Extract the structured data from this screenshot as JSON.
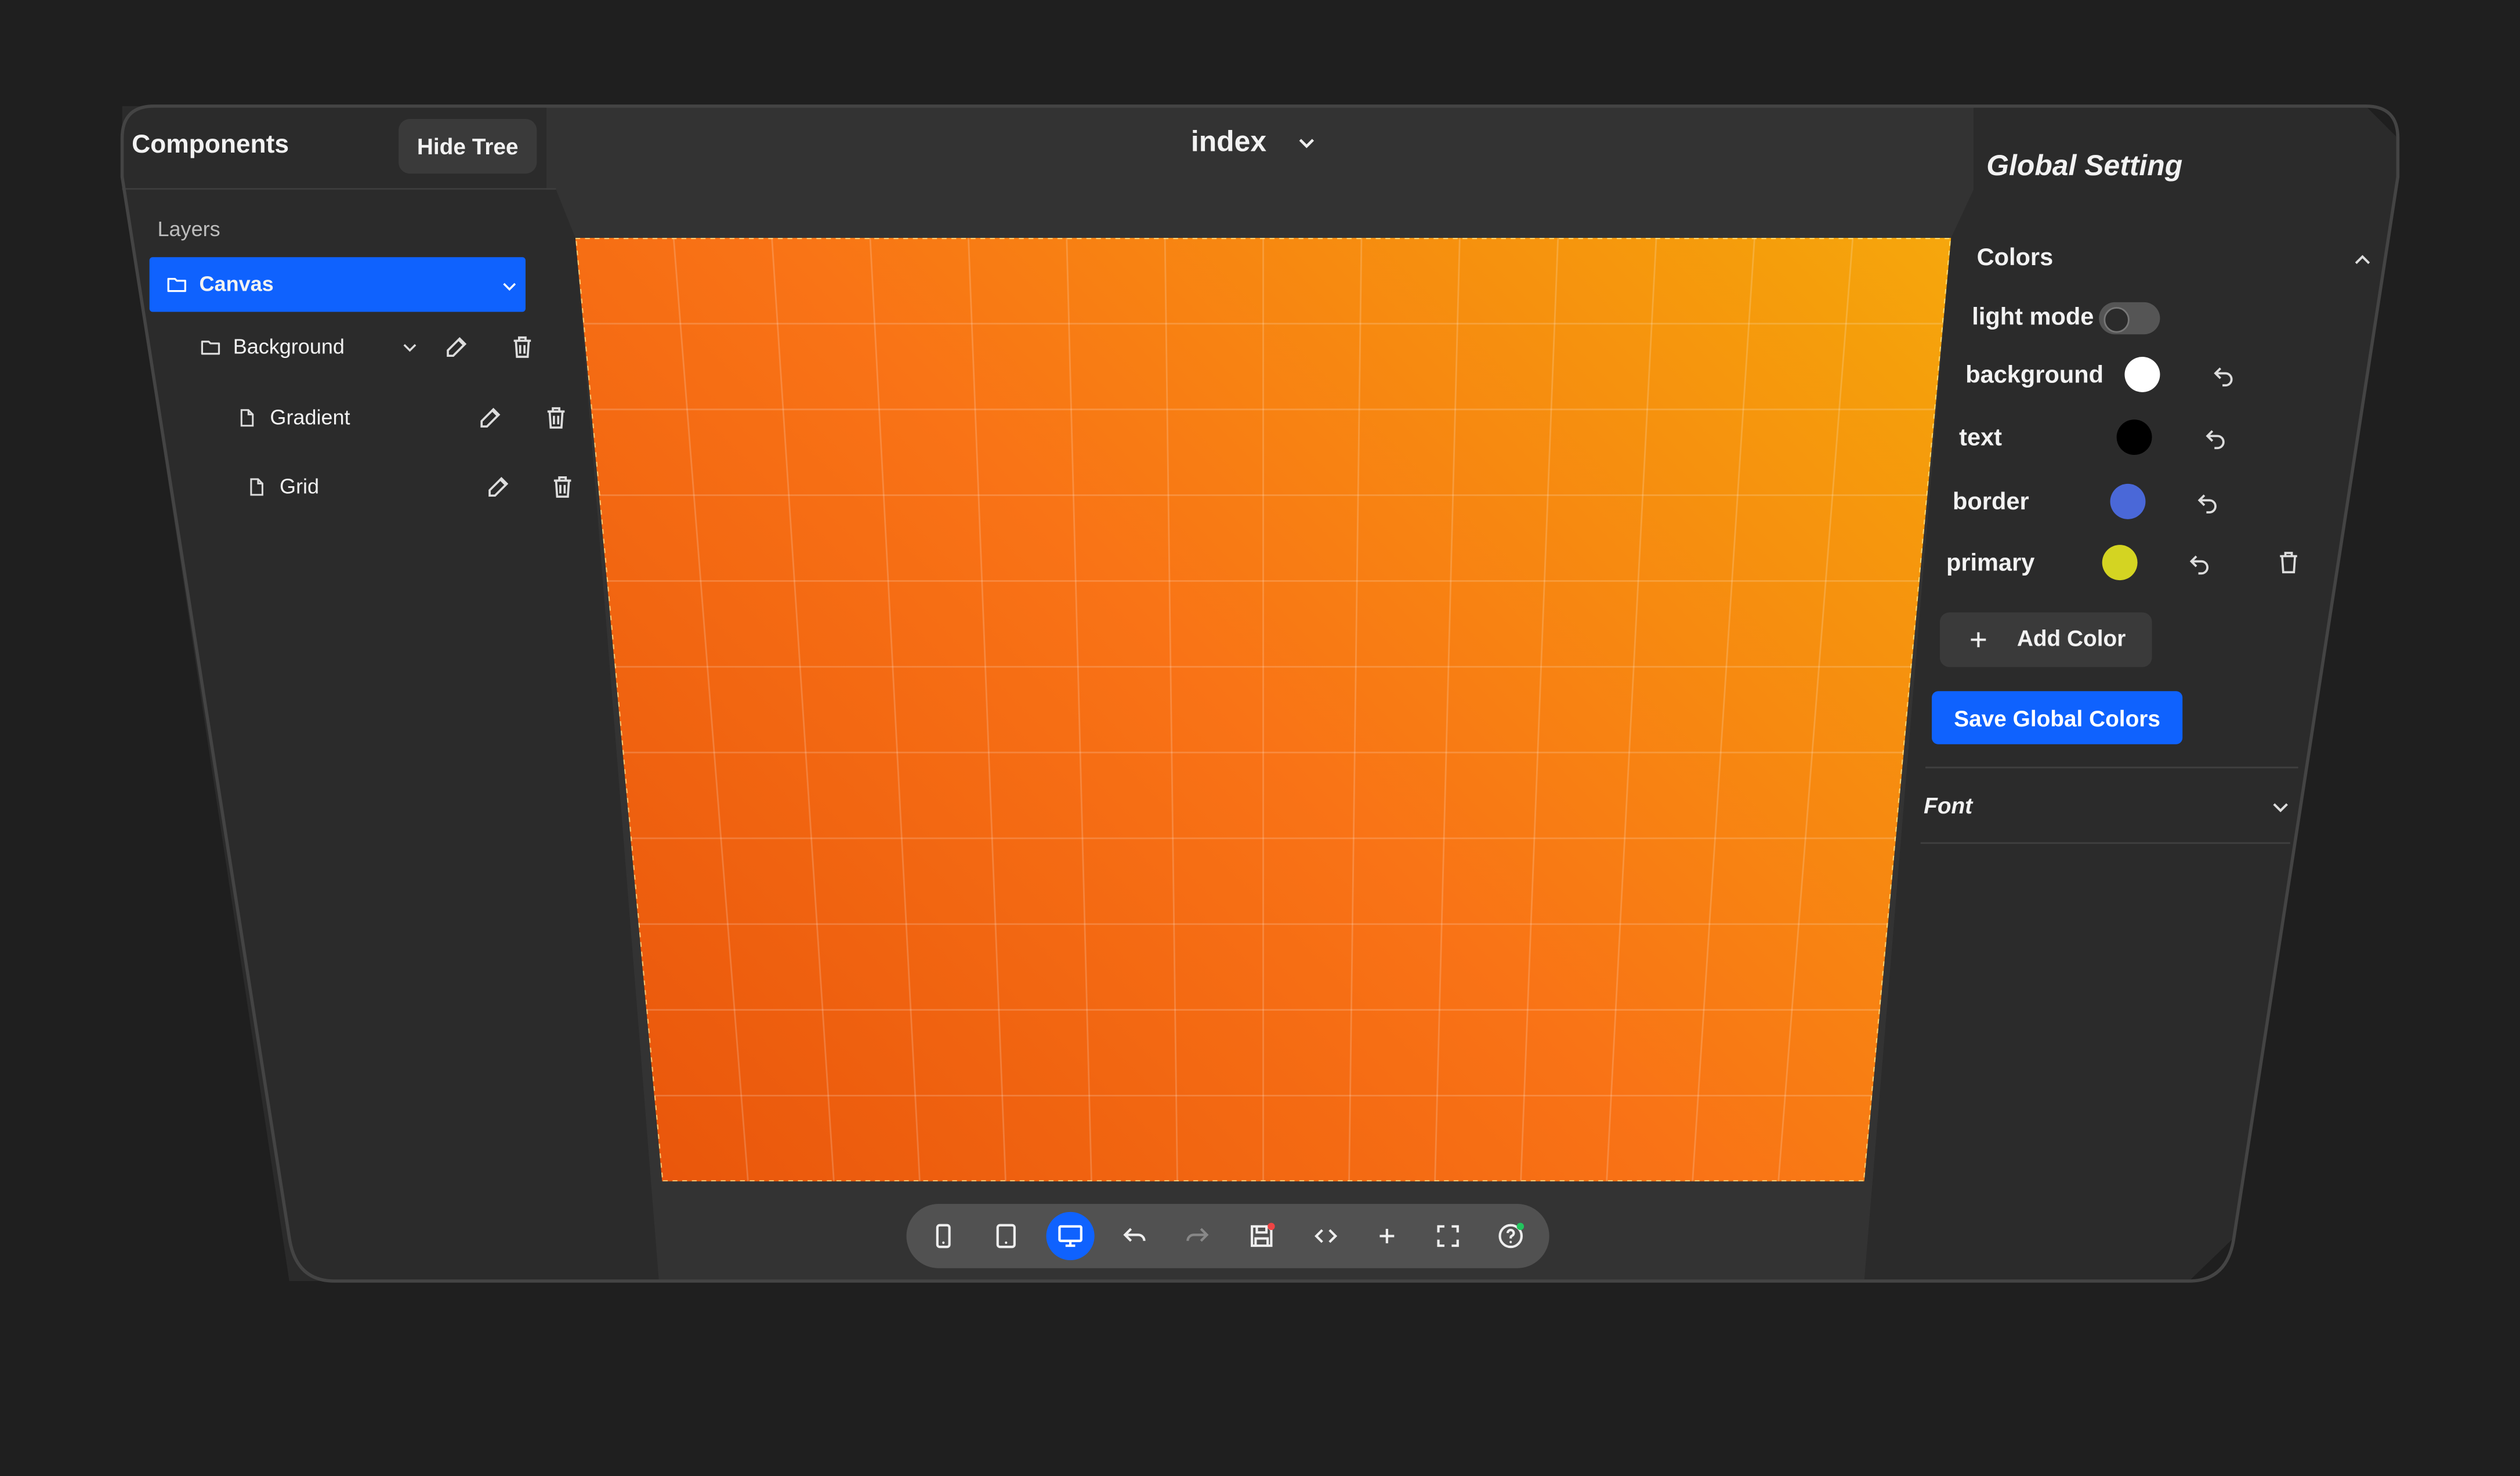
{
  "left_panel": {
    "title": "Components",
    "hide_tree_label": "Hide Tree",
    "layers_label": "Layers",
    "tree": {
      "canvas": {
        "label": "Canvas"
      },
      "background": {
        "label": "Background"
      },
      "gradient": {
        "label": "Gradient"
      },
      "grid": {
        "label": "Grid"
      }
    }
  },
  "center": {
    "page_selector": "index",
    "canvas_gradient": [
      "#facc15",
      "#f59e0b",
      "#f97316",
      "#ea580c",
      "#dc2626"
    ]
  },
  "right_panel": {
    "title": "Global Setting",
    "colors_section": {
      "title": "Colors",
      "light_mode_label": "light mode",
      "light_mode_on": false,
      "items": [
        {
          "name": "background",
          "color": "#ffffff"
        },
        {
          "name": "text",
          "color": "#000000"
        },
        {
          "name": "border",
          "color": "#4a68d8"
        },
        {
          "name": "primary",
          "color": "#d4d422"
        }
      ],
      "add_color_label": "Add Color",
      "save_label": "Save Global Colors"
    },
    "font_section": {
      "title": "Font"
    }
  },
  "toolbar": {
    "buttons": [
      "phone-icon",
      "tablet-icon",
      "desktop-icon",
      "undo-icon",
      "redo-icon",
      "save-icon",
      "code-icon",
      "plus-icon",
      "fullscreen-icon",
      "help-icon"
    ],
    "active": "desktop-icon"
  },
  "colors": {
    "accent": "#0f62fe",
    "panel": "#2b2b2b",
    "page_bg": "#1f1f1f"
  }
}
